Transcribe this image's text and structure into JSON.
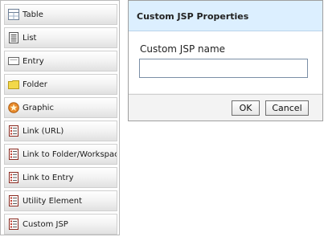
{
  "palette": {
    "items": [
      {
        "label": "Table",
        "icon": "table-icon"
      },
      {
        "label": "List",
        "icon": "list-icon"
      },
      {
        "label": "Entry",
        "icon": "entry-icon"
      },
      {
        "label": "Folder",
        "icon": "folder-icon"
      },
      {
        "label": "Graphic",
        "icon": "graphic-icon"
      },
      {
        "label": "Link (URL)",
        "icon": "link-url-icon"
      },
      {
        "label": "Link to Folder/Workspace",
        "icon": "link-folder-icon"
      },
      {
        "label": "Link to Entry",
        "icon": "link-entry-icon"
      },
      {
        "label": "Utility Element",
        "icon": "utility-element-icon"
      },
      {
        "label": "Custom JSP",
        "icon": "custom-jsp-icon"
      }
    ]
  },
  "dialog": {
    "title": "Custom JSP Properties",
    "field_label": "Custom JSP name",
    "field_value": "",
    "ok_label": "OK",
    "cancel_label": "Cancel"
  },
  "colors": {
    "dialog_header": "#dcefff",
    "folder_yellow": "#f3d84a",
    "graphic_orange": "#e98a2a",
    "doc_red": "#c0392b"
  }
}
